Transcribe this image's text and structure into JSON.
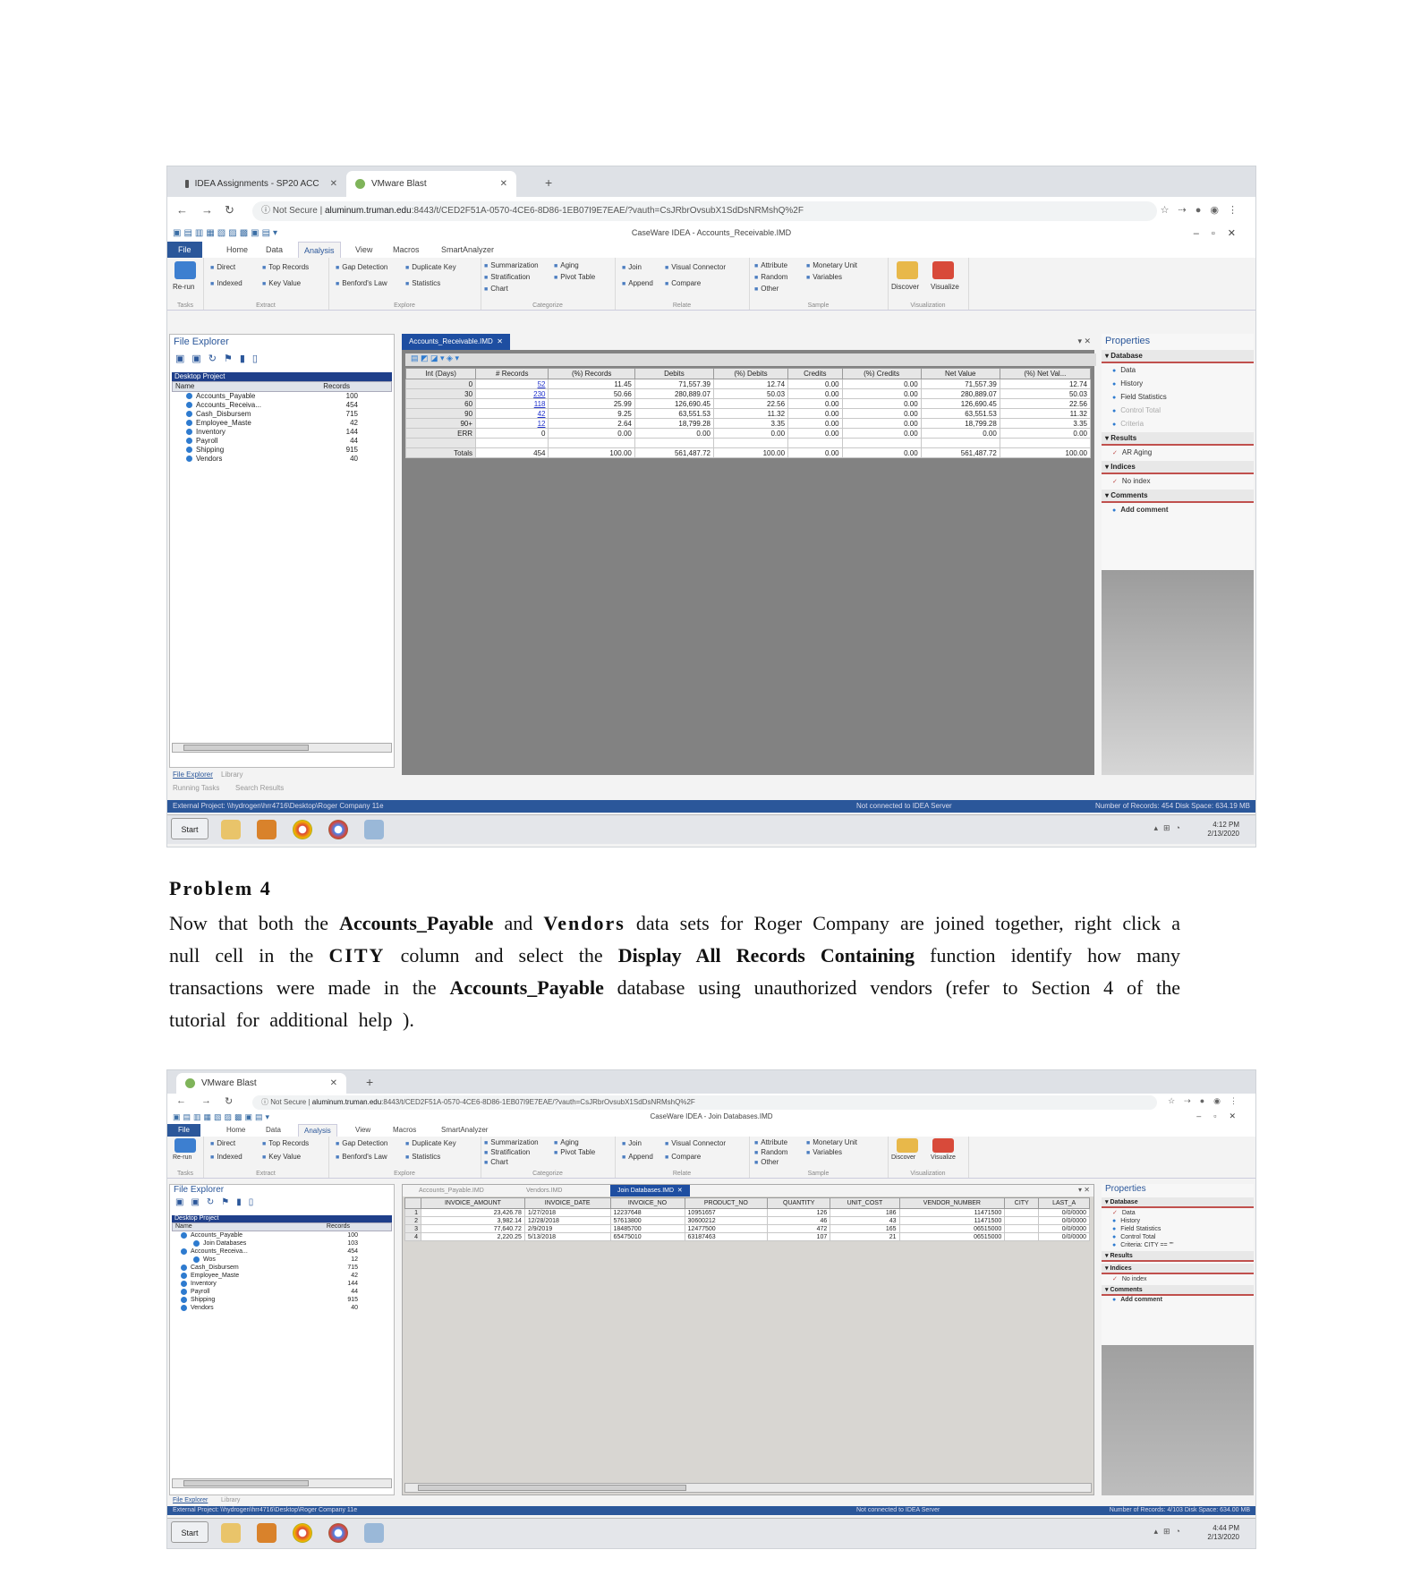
{
  "screenshot1": {
    "tabs": [
      "IDEA Assignments - SP20 ACC",
      "VMware Blast"
    ],
    "url_prefix": "Not Secure",
    "url_host": "aluminum.truman.edu",
    "url_rest": ":8443/t/CED2F51A-0570-4CE6-8D86-1EB07I9E7EAE/?vauth=CsJRbrOvsubX1SdDsNRMshQ%2F",
    "window_title": "CaseWare IDEA - Accounts_Receivable.IMD",
    "ribbon_tabs": [
      "File",
      "Home",
      "Data",
      "Analysis",
      "View",
      "Macros",
      "SmartAnalyzer"
    ],
    "ribbon_groups": [
      "Tasks",
      "Extract",
      "Explore",
      "Categorize",
      "Relate",
      "Sample",
      "Visualization"
    ],
    "ribbon_cmds": {
      "rerun": "Re-run",
      "direct": "Direct",
      "top_records": "Top Records",
      "indexed": "Indexed",
      "key_value": "Key Value",
      "gap_detection": "Gap Detection",
      "duplicate_key": "Duplicate Key",
      "benfords_law": "Benford's Law",
      "statistics": "Statistics",
      "summarization": "Summarization",
      "aging": "Aging",
      "stratification": "Stratification",
      "pivot_table": "Pivot Table",
      "chart": "Chart",
      "join": "Join",
      "visual_connector": "Visual Connector",
      "append": "Append",
      "compare": "Compare",
      "attribute": "Attribute",
      "monetary_unit": "Monetary Unit",
      "random": "Random",
      "variables": "Variables",
      "other": "Other",
      "discover": "Discover",
      "visualize": "Visualize"
    },
    "file_explorer": {
      "title": "File Explorer",
      "project": "Desktop Project",
      "col_name": "Name",
      "col_records": "Records",
      "items": [
        {
          "name": "Accounts_Payable",
          "records": "100"
        },
        {
          "name": "Accounts_Receiva...",
          "records": "454"
        },
        {
          "name": "Cash_Disbursem",
          "records": "715"
        },
        {
          "name": "Employee_Maste",
          "records": "42"
        },
        {
          "name": "Inventory",
          "records": "144"
        },
        {
          "name": "Payroll",
          "records": "44"
        },
        {
          "name": "Shipping",
          "records": "915"
        },
        {
          "name": "Vendors",
          "records": "40"
        }
      ],
      "bottom_tabs": [
        "File Explorer",
        "Library"
      ],
      "lower_tabs": [
        "Running Tasks",
        "Search Results"
      ]
    },
    "doc_tab": "Accounts_Receivable.IMD",
    "table": {
      "headers": [
        "Int (Days)",
        "# Records",
        "(%) Records",
        "Debits",
        "(%) Debits",
        "Credits",
        "(%) Credits",
        "Net Value",
        "(%) Net Val..."
      ],
      "rows": [
        [
          "0",
          "52",
          "11.45",
          "71,557.39",
          "12.74",
          "0.00",
          "0.00",
          "71,557.39",
          "12.74"
        ],
        [
          "30",
          "230",
          "50.66",
          "280,889.07",
          "50.03",
          "0.00",
          "0.00",
          "280,889.07",
          "50.03"
        ],
        [
          "60",
          "118",
          "25.99",
          "126,690.45",
          "22.56",
          "0.00",
          "0.00",
          "126,690.45",
          "22.56"
        ],
        [
          "90",
          "42",
          "9.25",
          "63,551.53",
          "11.32",
          "0.00",
          "0.00",
          "63,551.53",
          "11.32"
        ],
        [
          "90+",
          "12",
          "2.64",
          "18,799.28",
          "3.35",
          "0.00",
          "0.00",
          "18,799.28",
          "3.35"
        ],
        [
          "ERR",
          "0",
          "0.00",
          "0.00",
          "0.00",
          "0.00",
          "0.00",
          "0.00",
          "0.00"
        ],
        [
          "",
          "",
          "",
          "",
          "",
          "",
          "",
          "",
          ""
        ],
        [
          "Totals",
          "454",
          "100.00",
          "561,487.72",
          "100.00",
          "0.00",
          "0.00",
          "561,487.72",
          "100.00"
        ]
      ]
    },
    "properties": {
      "title": "Properties",
      "sections": [
        {
          "name": "Database",
          "items": [
            "Data",
            "History",
            "Field Statistics",
            "Control Total",
            "Criteria"
          ]
        },
        {
          "name": "Results",
          "items": [
            "AR Aging"
          ]
        },
        {
          "name": "Indices",
          "items": [
            "No index"
          ]
        },
        {
          "name": "Comments",
          "items": [
            "Add comment"
          ]
        }
      ]
    },
    "status_left": "External Project: \\\\hydrogen\\hrr4716\\Desktop\\Roger Company 11e",
    "status_mid": "Not connected to IDEA Server",
    "status_right": "Number of Records: 454    Disk Space: 634.19 MB",
    "taskbar_start": "Start",
    "clock_time": "4:12 PM",
    "clock_date": "2/13/2020"
  },
  "problem_title": "Problem 4",
  "paragraph": {
    "t1": "Now that both the ",
    "b1": "Accounts_Payable",
    "t2": " and ",
    "b2": "Vendors",
    "t3": " data sets for Roger Company are joined together, right click a null cell in the ",
    "b3": "CITY",
    "t4": " column and select the ",
    "b4": "Display All Records Containing",
    "t5": " function identify how many transactions were made in the ",
    "b5": "Accounts_Payable",
    "t6": " database using unauthorized vendors (refer to Section 4 of the tutorial for additional help )."
  },
  "screenshot2": {
    "tabs": [
      "VMware Blast"
    ],
    "window_title": "CaseWare IDEA - Join Databases.IMD",
    "doc_tabs": [
      "Accounts_Payable.IMD",
      "Vendors.IMD",
      "Join Databases.IMD"
    ],
    "file_items": [
      {
        "name": "Accounts_Payable",
        "records": "100",
        "level": 0
      },
      {
        "name": "Join Databases",
        "records": "103",
        "level": 1
      },
      {
        "name": "Accounts_Receiva...",
        "records": "454",
        "level": 0
      },
      {
        "name": "Wos",
        "records": "12",
        "level": 1
      },
      {
        "name": "Cash_Disbursem",
        "records": "715",
        "level": 0
      },
      {
        "name": "Employee_Maste",
        "records": "42",
        "level": 0
      },
      {
        "name": "Inventory",
        "records": "144",
        "level": 0
      },
      {
        "name": "Payroll",
        "records": "44",
        "level": 0
      },
      {
        "name": "Shipping",
        "records": "915",
        "level": 0
      },
      {
        "name": "Vendors",
        "records": "40",
        "level": 0
      }
    ],
    "table": {
      "headers": [
        "",
        "INVOICE_AMOUNT",
        "INVOICE_DATE",
        "INVOICE_NO",
        "PRODUCT_NO",
        "QUANTITY",
        "UNIT_COST",
        "VENDOR_NUMBER",
        "CITY",
        "LAST_A"
      ],
      "rows": [
        [
          "1",
          "23,426.78",
          "1/27/2018",
          "12237648",
          "10951657",
          "126",
          "186",
          "11471500",
          "",
          "0/0/0000"
        ],
        [
          "2",
          "3,982.14",
          "12/28/2018",
          "57613800",
          "30600212",
          "46",
          "43",
          "11471500",
          "",
          "0/0/0000"
        ],
        [
          "3",
          "77,640.72",
          "2/9/2019",
          "18485700",
          "12477500",
          "472",
          "165",
          "06515000",
          "",
          "0/0/0000"
        ],
        [
          "4",
          "2,220.25",
          "5/13/2018",
          "65475010",
          "63187463",
          "107",
          "21",
          "06515000",
          "",
          "0/0/0000"
        ]
      ]
    },
    "properties": {
      "sections": [
        {
          "name": "Database",
          "items": [
            "Data",
            "History",
            "Field Statistics",
            "Control Total",
            "Criteria: CITY == \"\""
          ]
        },
        {
          "name": "Results",
          "items": []
        },
        {
          "name": "Indices",
          "items": [
            "No index"
          ]
        },
        {
          "name": "Comments",
          "items": [
            "Add comment"
          ]
        }
      ]
    },
    "status_right": "Number of Records: 4/103    Disk Space: 634.00 MB",
    "clock_time": "4:44 PM",
    "clock_date": "2/13/2020"
  }
}
